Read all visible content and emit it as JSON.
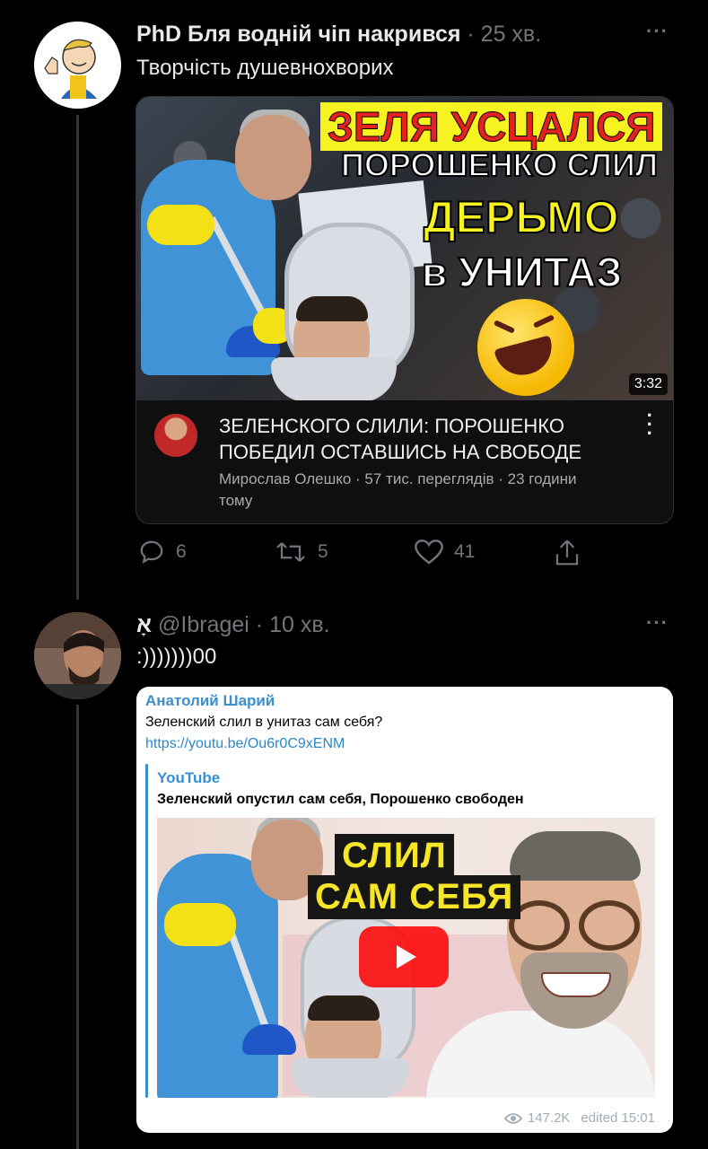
{
  "tweet1": {
    "name": "PhD Бля водній чіп накрився",
    "time": "· 25 хв.",
    "text": "Творчість душевнохворих",
    "more": "···",
    "card": {
      "headline_line1": "ЗЕЛЯ УСЦАЛСЯ",
      "headline_line2": "ПОРОШЕНКО СЛИЛ",
      "headline_line3": "ДЕРЬМО",
      "headline_line4": "в УНИТАЗ",
      "duration": "3:32",
      "video_title": "ЗЕЛЕНСКОГО СЛИЛИ: ПОРОШЕНКО ПОБЕДИЛ ОСТАВШИСЬ НА СВОБОДЕ",
      "video_meta": "Мирослав Олешко · 57 тис. переглядів · 23 години тому",
      "dots": "⋮"
    },
    "actions": {
      "reply_count": "6",
      "retweet_count": "5",
      "like_count": "41"
    }
  },
  "tweet2": {
    "name": "אָ",
    "handle": "@Ibragei",
    "time": "· 10 хв.",
    "text": ":)))))))00",
    "more": "···",
    "telegram": {
      "author": "Анатолий Шарий",
      "message": "Зеленский слил в унитаз сам себя?",
      "link": "https://youtu.be/Ou6r0C9xENM",
      "site": "YouTube",
      "preview_title": "Зеленский опустил сам себя, Порошенко свободен",
      "caption_line1": "СЛИЛ",
      "caption_line2": "САМ СЕБЯ",
      "views": "147.2K",
      "edited": "edited 15:01"
    }
  },
  "colors": {
    "background": "#000000",
    "text_primary": "#e7e9ea",
    "text_secondary": "#71767b",
    "telegram_blue": "#3a8fcf",
    "youtube_red": "#ff0000"
  }
}
